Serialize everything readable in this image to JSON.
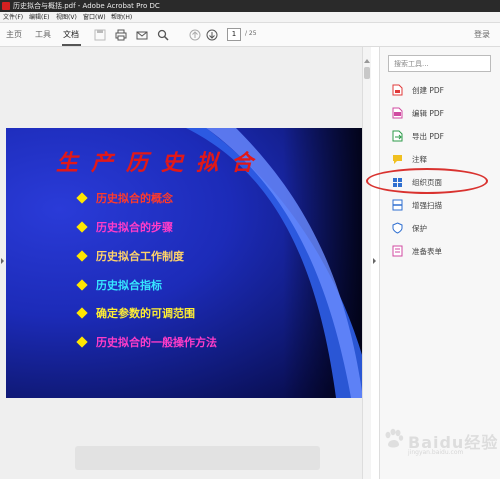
{
  "window": {
    "title": "历史拟合与概括.pdf - Adobe Acrobat Pro DC"
  },
  "menu": [
    "文件(F)",
    "编辑(E)",
    "视图(V)",
    "窗口(W)",
    "帮助(H)"
  ],
  "toolbar": {
    "tabs": [
      "主页",
      "工具",
      "文档"
    ],
    "active_tab": "文档",
    "page_current": "1",
    "page_total": "/ 25",
    "login": "登录"
  },
  "slide": {
    "title": "生产历史拟合",
    "bullets": [
      {
        "text": "历史拟合的概念",
        "color": "#ff3a2a"
      },
      {
        "text": "历史拟合的步骤",
        "color": "#ff3cc8"
      },
      {
        "text": "历史拟合工作制度",
        "color": "#ffd36a"
      },
      {
        "text": "历史拟合指标",
        "color": "#36e6ff"
      },
      {
        "text": "确定参数的可调范围",
        "color": "#ffee33"
      },
      {
        "text": "历史拟合的一般操作方法",
        "color": "#ff3cc8"
      }
    ]
  },
  "panel": {
    "search_placeholder": "搜索工具...",
    "tools": [
      {
        "label": "创建 PDF",
        "icon": "create-pdf-icon",
        "color": "#e03a3a"
      },
      {
        "label": "编辑 PDF",
        "icon": "edit-pdf-icon",
        "color": "#d04aa0"
      },
      {
        "label": "导出 PDF",
        "icon": "export-pdf-icon",
        "color": "#2d9b4a"
      },
      {
        "label": "注释",
        "icon": "comment-icon",
        "color": "#f0c020"
      },
      {
        "label": "组织页面",
        "icon": "organize-pages-icon",
        "color": "#2f6fd0"
      },
      {
        "label": "增强扫描",
        "icon": "enhance-scans-icon",
        "color": "#2f6fd0"
      },
      {
        "label": "保护",
        "icon": "protect-icon",
        "color": "#2f6fd0"
      },
      {
        "label": "准备表单",
        "icon": "prepare-form-icon",
        "color": "#d04aa0"
      }
    ]
  },
  "watermark": {
    "brand": "Baidu经验",
    "url": "jingyan.baidu.com"
  }
}
